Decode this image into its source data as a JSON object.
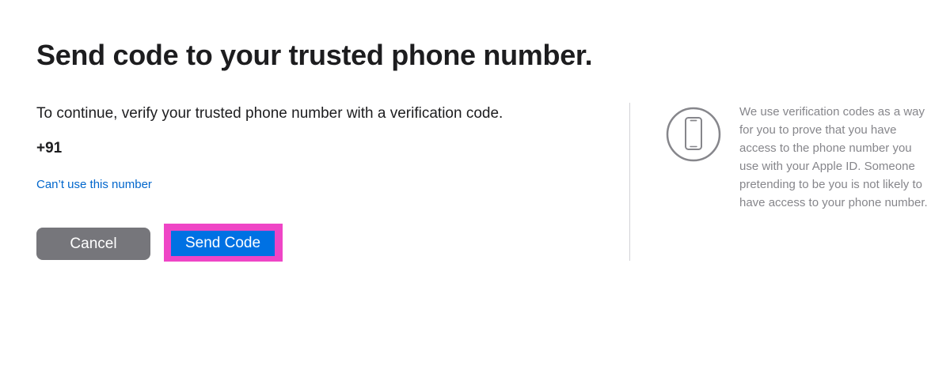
{
  "header": {
    "title": "Send code to your trusted phone number."
  },
  "main": {
    "instructions": "To continue, verify your trusted phone number with a verification code.",
    "phone_number": "+91",
    "alt_link": "Can’t use this number",
    "cancel_label": "Cancel",
    "send_label": "Send Code"
  },
  "aside": {
    "icon": "iphone-icon",
    "info": "We use verification codes as a way for you to prove that you have access to the phone number you use with your Apple ID. Someone pretending to be you is not likely to have access to your phone number."
  },
  "colors": {
    "accent": "#0071e3",
    "link": "#0066cc",
    "cancel_button": "#76767b",
    "highlight": "#ef45c6",
    "muted_text": "#86868b"
  }
}
